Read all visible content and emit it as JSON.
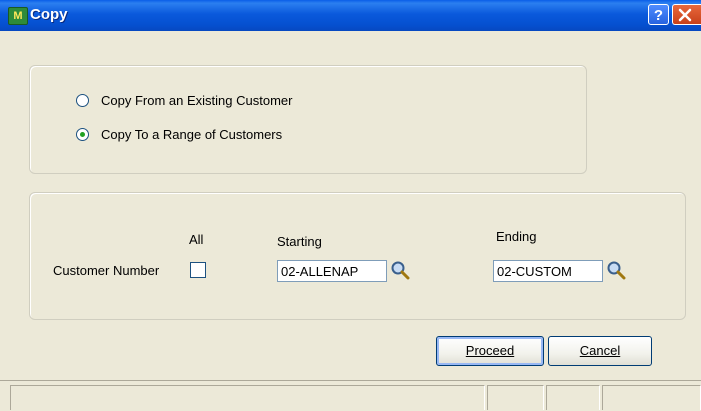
{
  "window": {
    "title": "Copy",
    "app_icon": "mas90-app-icon",
    "help_icon": "help-icon",
    "close_icon": "close-icon"
  },
  "copy_options": {
    "option_from": "Copy From an Existing Customer",
    "option_to": "Copy To a Range of Customers",
    "selected": "Copy To a Range of Customers"
  },
  "range": {
    "row_label": "Customer Number",
    "all_label": "All",
    "all_checked": false,
    "starting_label": "Starting",
    "starting_value": "02-ALLENAP",
    "ending_label": "Ending",
    "ending_value": "02-CUSTOM"
  },
  "buttons": {
    "proceed": "Proceed",
    "cancel": "Cancel"
  },
  "colors": {
    "titlebar": "#0a59dc",
    "dialog_bg": "#ece9d8",
    "radio_dot": "#21a121"
  }
}
